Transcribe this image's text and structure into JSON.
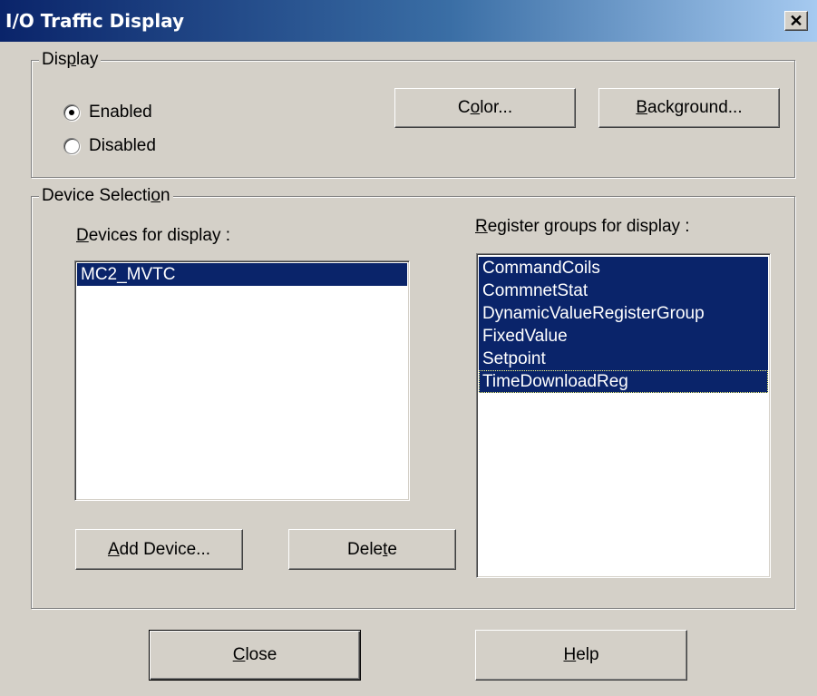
{
  "window": {
    "title": "I/O Traffic Display",
    "close_glyph": "✕"
  },
  "display_group": {
    "legend": "Display",
    "radios": [
      {
        "label": "Enabled",
        "checked": true
      },
      {
        "label": "Disabled",
        "checked": false
      }
    ],
    "color_button": "Color...",
    "background_button": "Background..."
  },
  "device_group": {
    "legend": "Device Selection",
    "devices_label": "Devices for display :",
    "devices": [
      "MC2_MVTC"
    ],
    "register_label": "Register groups for display :",
    "register_groups": [
      "CommandCoils",
      "CommnetStat",
      "DynamicValueRegisterGroup",
      "FixedValue",
      "Setpoint",
      "TimeDownloadReg"
    ],
    "add_device_button": "Add Device...",
    "delete_button": "Delete"
  },
  "footer": {
    "close_button": "Close",
    "help_button": "Help"
  },
  "colors": {
    "selection": "#0a246a",
    "dialog_face": "#d4d0c8"
  }
}
